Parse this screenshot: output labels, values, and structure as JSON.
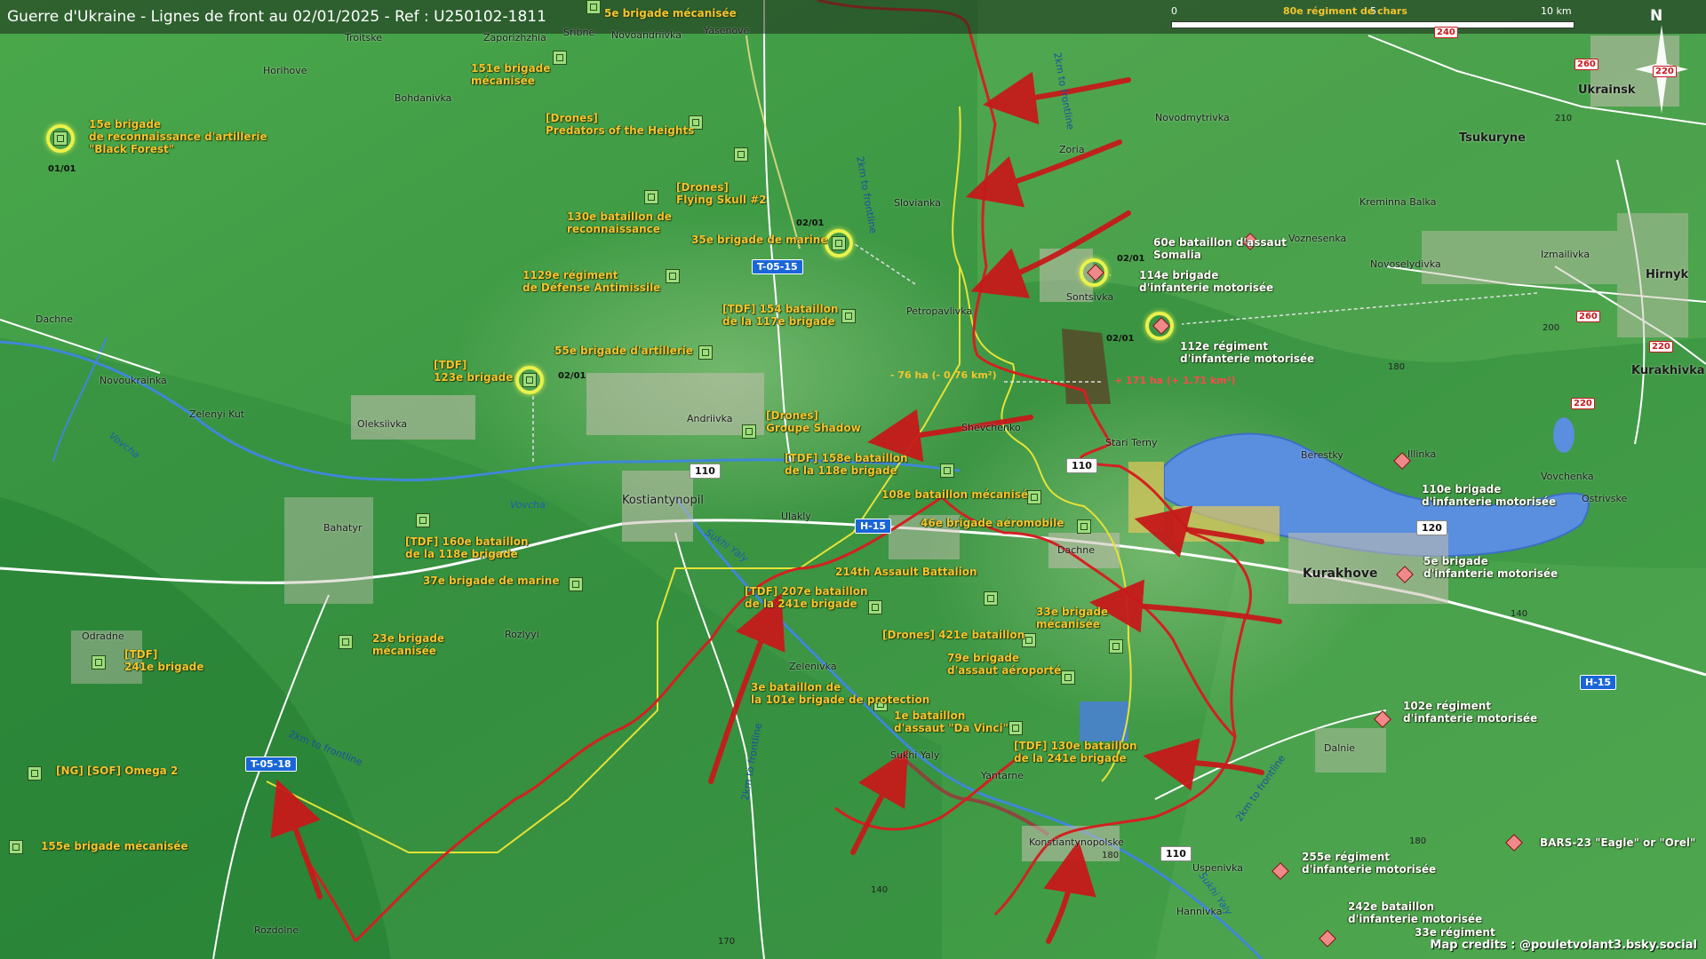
{
  "title": "Guerre d'Ukraine - Lignes de front au 02/01/2025 - Ref : U250102-1811",
  "scale": {
    "ticks": [
      "0",
      "5",
      "10 km"
    ],
    "unit_label": "80e régiment de chars"
  },
  "compass": "N",
  "credits": "Map credits : @pouletvolant3.bsky.social",
  "colors": {
    "ua_unit": "#9bde7a",
    "ru_unit": "#f08a8a",
    "frontline": "#d42020",
    "control_line": "#e6e336",
    "water": "#5a8ede",
    "terrain": "#3f9a45",
    "roads_label": "#1a66d8"
  },
  "ua_units": [
    {
      "label_lines": [
        "5e brigade mécanisée"
      ],
      "icon": "ua-unit-icon"
    },
    {
      "label_lines": [
        "151e brigade",
        "mécanisée"
      ],
      "icon": "ua-unit-icon"
    },
    {
      "label_lines": [
        "15e brigade",
        "de reconnaissance d'artillerie",
        "\"Black Forest\""
      ],
      "icon": "ua-unit-icon"
    },
    {
      "label_lines": [
        "[Drones]",
        "Predators of the Heights"
      ],
      "icon": "ua-unit-icon"
    },
    {
      "label_lines": [
        "[Drones]",
        "Flying Skull #2"
      ],
      "icon": "ua-unit-icon"
    },
    {
      "label_lines": [
        "130e bataillon de",
        "reconnaissance"
      ],
      "icon": "ua-unit-icon"
    },
    {
      "label_lines": [
        "35e brigade de marine"
      ],
      "icon": "ua-unit-icon"
    },
    {
      "label_lines": [
        "1129e régiment",
        "de Défense Antimissile"
      ],
      "icon": "ua-unit-icon"
    },
    {
      "label_lines": [
        "[TDF] 154 bataillon",
        "de la 117e brigade"
      ],
      "icon": "ua-unit-icon"
    },
    {
      "label_lines": [
        "55e brigade d'artillerie"
      ],
      "icon": "ua-unit-icon"
    },
    {
      "label_lines": [
        "[TDF]",
        "123e brigade"
      ],
      "icon": "ua-unit-icon"
    },
    {
      "label_lines": [
        "[Drones]",
        "Groupe Shadow"
      ],
      "icon": "ua-unit-icon"
    },
    {
      "label_lines": [
        "[TDF] 158e bataillon",
        "de la 118e brigade"
      ],
      "icon": "ua-unit-icon"
    },
    {
      "label_lines": [
        "108e bataillon mécanisé"
      ],
      "icon": "ua-unit-icon"
    },
    {
      "label_lines": [
        "46e brigade aéromobile"
      ],
      "icon": "ua-unit-icon"
    },
    {
      "label_lines": [
        "[TDF] 160e bataillon",
        "de la 118e brigade"
      ],
      "icon": "ua-unit-icon"
    },
    {
      "label_lines": [
        "37e brigade de marine"
      ],
      "icon": "ua-unit-icon"
    },
    {
      "label_lines": [
        "214th Assault Battalion"
      ],
      "icon": "ua-unit-icon"
    },
    {
      "label_lines": [
        "[TDF] 207e bataillon",
        "de la 241e brigade"
      ],
      "icon": "ua-unit-icon"
    },
    {
      "label_lines": [
        "33e brigade",
        "mécanisée"
      ],
      "icon": "ua-unit-icon"
    },
    {
      "label_lines": [
        "23e brigade",
        "mécanisée"
      ],
      "icon": "ua-unit-icon"
    },
    {
      "label_lines": [
        "[TDF]",
        "241e brigade"
      ],
      "icon": "ua-unit-icon"
    },
    {
      "label_lines": [
        "[Drones] 421e bataillon"
      ],
      "icon": "ua-unit-icon"
    },
    {
      "label_lines": [
        "79e brigade",
        "d'assaut aéroporté"
      ],
      "icon": "ua-unit-icon"
    },
    {
      "label_lines": [
        "3e bataillon de",
        "la 101e brigade de protection"
      ],
      "icon": "ua-unit-icon"
    },
    {
      "label_lines": [
        "1e bataillon",
        "d'assaut \"Da Vinci\""
      ],
      "icon": "ua-unit-icon"
    },
    {
      "label_lines": [
        "[TDF] 130e bataillon",
        "de la 241e brigade"
      ],
      "icon": "ua-unit-icon"
    },
    {
      "label_lines": [
        "[NG] [SOF] Omega 2"
      ],
      "icon": "ua-unit-icon"
    },
    {
      "label_lines": [
        "155e brigade mécanisée"
      ],
      "icon": "ua-unit-icon"
    }
  ],
  "ru_units": [
    {
      "label_lines": [
        "60e bataillon d'assaut",
        "Somalia"
      ],
      "icon": "ru-unit-icon"
    },
    {
      "label_lines": [
        "114e brigade",
        "d'infanterie motorisée"
      ],
      "icon": "ru-unit-icon"
    },
    {
      "label_lines": [
        "112e régiment",
        "d'infanterie motorisée"
      ],
      "icon": "ru-unit-icon"
    },
    {
      "label_lines": [
        "110e brigade",
        "d'infanterie motorisée"
      ],
      "icon": "ru-unit-icon"
    },
    {
      "label_lines": [
        "5e brigade",
        "d'infanterie motorisée"
      ],
      "icon": "ru-unit-icon"
    },
    {
      "label_lines": [
        "102e régiment",
        "d'infanterie motorisée"
      ],
      "icon": "ru-unit-icon"
    },
    {
      "label_lines": [
        "BARS-23 \"Eagle\" or \"Orel\""
      ],
      "icon": "ru-unit-icon"
    },
    {
      "label_lines": [
        "255e régiment",
        "d'infanterie motorisée"
      ],
      "icon": "ru-unit-icon"
    },
    {
      "label_lines": [
        "242e bataillon",
        "d'infanterie motorisée"
      ],
      "icon": "ru-unit-icon"
    },
    {
      "label_lines": [
        "33e régiment"
      ],
      "icon": "ru-unit-icon"
    }
  ],
  "towns": [
    "Troitske",
    "Zaporizhzhia",
    "Sribne",
    "Novoandriivka",
    "Yasenove",
    "Horihove",
    "Bohdanivka",
    "Zoria",
    "Novodmytrivka",
    "Slovianka",
    "Sontsivka",
    "Petropavlivka",
    "Kreminna Balka",
    "Voznesenka",
    "Novoselydivka",
    "Izmailivka",
    "Dachne",
    "Novoukrainka",
    "Zelenyi Kut",
    "Oleksiivka",
    "Andriivka",
    "Shevchenko",
    "Stari Terny",
    "Berestky",
    "Illinka",
    "Vovchenka",
    "Ostrivske",
    "Kostiantynopil",
    "Ulakly",
    "Dachne",
    "Bahatyr",
    "Odradne",
    "Rozlyyi",
    "Zelenivka",
    "Sukhi Yaly",
    "Yantarne",
    "Konstiantynopolske",
    "Uspenivka",
    "Hannivka",
    "Rozdolne",
    "Dalnie"
  ],
  "big_towns": [
    "Ukrainsk",
    "Tsukuryne",
    "Hirnyk",
    "Kurakhivka",
    "Kurakhove"
  ],
  "rivers": [
    {
      "name": "Vovcha"
    },
    {
      "name": "Vovcha"
    },
    {
      "name": "Sukhi Yaly"
    },
    {
      "name": "Sukhi Yaly"
    }
  ],
  "distance_labels": [
    "2km to frontline",
    "2km to frontline",
    "2km to frontline",
    "2km to frontline",
    "2km to frontline"
  ],
  "road_labels": [
    "T-05-15",
    "H-15",
    "H-15",
    "T-05-18",
    "110",
    "110",
    "110",
    "120"
  ],
  "route_numbers": [
    "240",
    "260",
    "220",
    "260",
    "220",
    "220"
  ],
  "elevations": [
    "210",
    "200",
    "180",
    "140",
    "180",
    "170",
    "140",
    "180"
  ],
  "dates": [
    "01/01",
    "02/01",
    "02/01",
    "02/01",
    "02/01"
  ],
  "areas": {
    "lost": "- 76 ha (- 0.76 km²)",
    "gained": "+ 171 ha (+ 1.71 km²)"
  }
}
